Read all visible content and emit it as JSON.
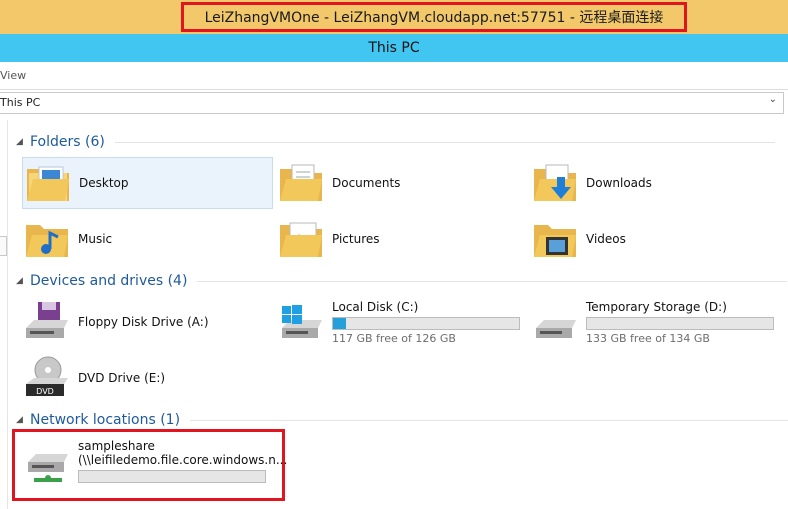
{
  "rdp": {
    "title": "LeiZhangVMOne - LeiZhangVM.cloudapp.net:57751 - 远程桌面连接"
  },
  "window": {
    "title": "This PC"
  },
  "ribbon": {
    "view_label": "View"
  },
  "address": {
    "path": "This PC"
  },
  "folders": {
    "header": "Folders (6)",
    "items": [
      {
        "label": "Desktop"
      },
      {
        "label": "Documents"
      },
      {
        "label": "Downloads"
      },
      {
        "label": "Music"
      },
      {
        "label": "Pictures"
      },
      {
        "label": "Videos"
      }
    ]
  },
  "devices": {
    "header": "Devices and drives (4)",
    "items": [
      {
        "label": "Floppy Disk Drive (A:)"
      },
      {
        "label": "Local Disk (C:)",
        "free_text": "117 GB free of 126 GB",
        "used_fraction": 0.07
      },
      {
        "label": "Temporary Storage (D:)",
        "free_text": "133 GB free of 134 GB",
        "used_fraction": 0.0
      },
      {
        "label": "DVD Drive (E:)",
        "badge": "DVD"
      }
    ]
  },
  "network": {
    "header": "Network locations (1)",
    "items": [
      {
        "name": "sampleshare",
        "path": "(\\\\leifiledemo.file.core.windows.n...",
        "used_fraction": 0.0
      }
    ]
  },
  "colors": {
    "accent": "#40c6f0",
    "rdp_bar": "#f2c86b",
    "highlight": "#e0151f",
    "header_text": "#1e5a9c",
    "drive_fill": "#26a0da"
  }
}
